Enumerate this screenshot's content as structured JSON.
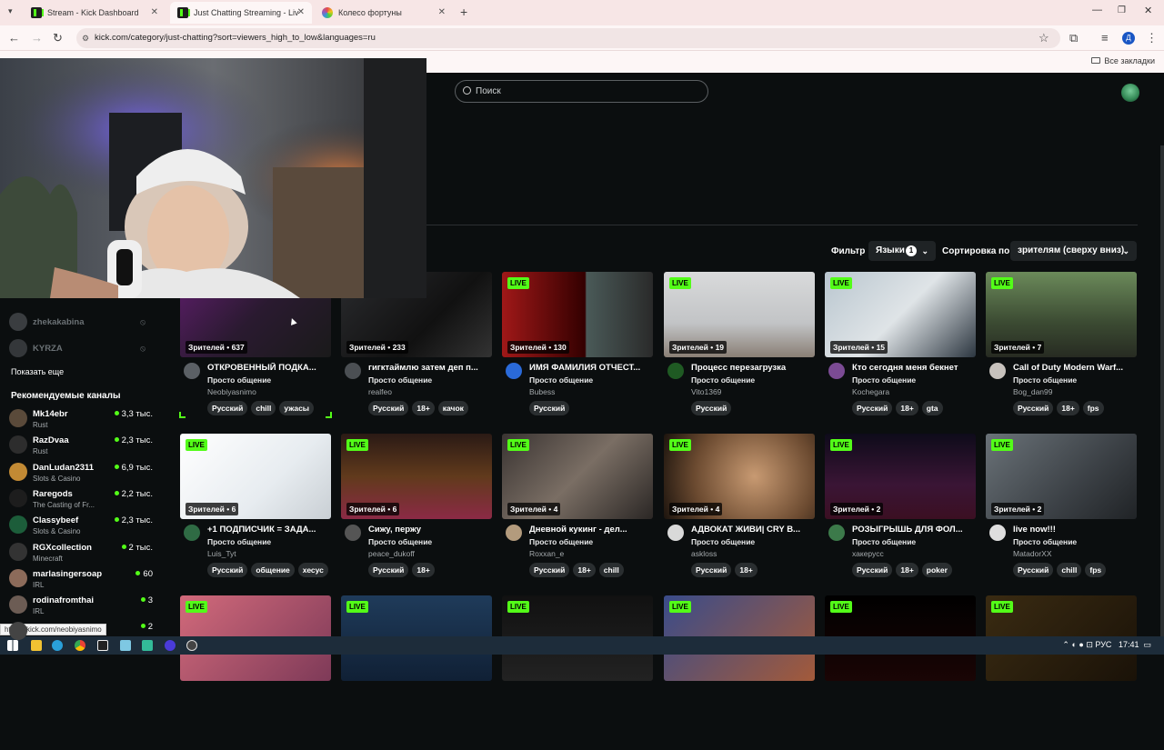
{
  "browser": {
    "tabs": [
      {
        "title": "Stream - Kick Dashboard",
        "active": false
      },
      {
        "title": "Just Chatting Streaming - Live S",
        "active": true
      },
      {
        "title": "Колесо фортуны",
        "active": false
      }
    ],
    "url": "kick.com/category/just-chatting?sort=viewers_high_to_low&languages=ru",
    "all_bookmarks": "Все закладки",
    "status_link": "https://kick.com/neobiyasnimo"
  },
  "header": {
    "search_placeholder": "Поиск"
  },
  "filters": {
    "filter_label": "Фильтр",
    "languages_label": "Языки",
    "languages_count": "1",
    "sort_label": "Сортировка по",
    "sort_value": "зрителям (сверху вниз)"
  },
  "sidebar": {
    "followed": [
      {
        "name": "zhekakabina"
      },
      {
        "name": "KYRZA"
      }
    ],
    "show_more": "Показать еще",
    "recommended_title": "Рекомендуемые каналы",
    "recommended": [
      {
        "name": "Mk14ebr",
        "category": "Rust",
        "viewers": "3,3 тыс."
      },
      {
        "name": "RazDvaa",
        "category": "Rust",
        "viewers": "2,3 тыс."
      },
      {
        "name": "DanLudan2311",
        "category": "Slots & Casino",
        "viewers": "6,9 тыс."
      },
      {
        "name": "Raregods",
        "category": "The Casting of Fr...",
        "viewers": "2,2 тыс."
      },
      {
        "name": "Classybeef",
        "category": "Slots & Casino",
        "viewers": "2,3 тыс."
      },
      {
        "name": "RGXcollection",
        "category": "Minecraft",
        "viewers": "2 тыс."
      },
      {
        "name": "marlasingersoap",
        "category": "IRL",
        "viewers": "60"
      },
      {
        "name": "rodinafromthai",
        "category": "IRL",
        "viewers": "3"
      },
      {
        "name": "",
        "category": "",
        "viewers": "2"
      }
    ]
  },
  "streams": [
    {
      "live": "",
      "viewers": "Зрителей • 637",
      "title": "ОТКРОВЕННЫЙ ПОДКА...",
      "category": "Просто общение",
      "channel": "Neobiyasnimo",
      "tags": [
        "Русский",
        "chill",
        "ужасы"
      ]
    },
    {
      "live": "",
      "viewers": "Зрителей • 233",
      "title": "гигктаймлю затем деп п...",
      "category": "Просто общение",
      "channel": "realfeo",
      "tags": [
        "Русский",
        "18+",
        "качок"
      ]
    },
    {
      "live": "LIVE",
      "viewers": "Зрителей • 130",
      "title": "ИМЯ ФАМИЛИЯ ОТЧЕСТ...",
      "category": "Просто общение",
      "channel": "Bubess",
      "tags": [
        "Русский"
      ]
    },
    {
      "live": "LIVE",
      "viewers": "Зрителей • 19",
      "title": "Процесс перезагрузка",
      "category": "Просто общение",
      "channel": "Vito1369",
      "tags": [
        "Русский"
      ]
    },
    {
      "live": "LIVE",
      "viewers": "Зрителей • 15",
      "title": "Кто сегодня меня бекнет",
      "category": "Просто общение",
      "channel": "Kochegara",
      "tags": [
        "Русский",
        "18+",
        "gta"
      ]
    },
    {
      "live": "LIVE",
      "viewers": "Зрителей • 7",
      "title": "Call of Duty Modern Warf...",
      "category": "Просто общение",
      "channel": "Bog_dan99",
      "tags": [
        "Русский",
        "18+",
        "fps"
      ]
    },
    {
      "live": "LIVE",
      "viewers": "Зрителей • 6",
      "title": "+1 ПОДПИСЧИК = ЗАДА...",
      "category": "Просто общение",
      "channel": "Luis_Tyt",
      "tags": [
        "Русский",
        "общение",
        "хесус"
      ]
    },
    {
      "live": "LIVE",
      "viewers": "Зрителей • 6",
      "title": "Сижу, пержу",
      "category": "Просто общение",
      "channel": "peace_dukoff",
      "tags": [
        "Русский",
        "18+"
      ]
    },
    {
      "live": "LIVE",
      "viewers": "Зрителей • 4",
      "title": "Дневной кукинг - дел...",
      "category": "Просто общение",
      "channel": "Roxxan_e",
      "tags": [
        "Русский",
        "18+",
        "chill"
      ]
    },
    {
      "live": "LIVE",
      "viewers": "Зрителей • 4",
      "title": "АДВОКАТ ЖИВИ| CRY B...",
      "category": "Просто общение",
      "channel": "askloss",
      "tags": [
        "Русский",
        "18+"
      ]
    },
    {
      "live": "LIVE",
      "viewers": "Зрителей • 2",
      "title": "РОЗЫГРЫШЬ ДЛЯ ФОЛ...",
      "category": "Просто общение",
      "channel": "хакерусс",
      "tags": [
        "Русский",
        "18+",
        "poker"
      ]
    },
    {
      "live": "LIVE",
      "viewers": "Зрителей • 2",
      "title": "live now!!!",
      "category": "Просто общение",
      "channel": "MatadorXX",
      "tags": [
        "Русский",
        "chill",
        "fps"
      ]
    },
    {
      "live": "LIVE",
      "viewers": "",
      "title": "",
      "category": "",
      "channel": "",
      "tags": []
    },
    {
      "live": "LIVE",
      "viewers": "",
      "title": "",
      "category": "",
      "channel": "",
      "tags": []
    },
    {
      "live": "LIVE",
      "viewers": "",
      "title": "",
      "category": "",
      "channel": "",
      "tags": []
    },
    {
      "live": "LIVE",
      "viewers": "",
      "title": "",
      "category": "",
      "channel": "",
      "tags": []
    },
    {
      "live": "LIVE",
      "viewers": "",
      "title": "",
      "category": "",
      "channel": "",
      "tags": []
    },
    {
      "live": "LIVE",
      "viewers": "",
      "title": "",
      "category": "",
      "channel": "",
      "tags": []
    }
  ],
  "taskbar": {
    "lang": "РУС",
    "time": "17:41"
  },
  "colors": {
    "accent": "#53fc18",
    "background": "#0b0e0f",
    "tag_bg": "#2a2e30"
  }
}
